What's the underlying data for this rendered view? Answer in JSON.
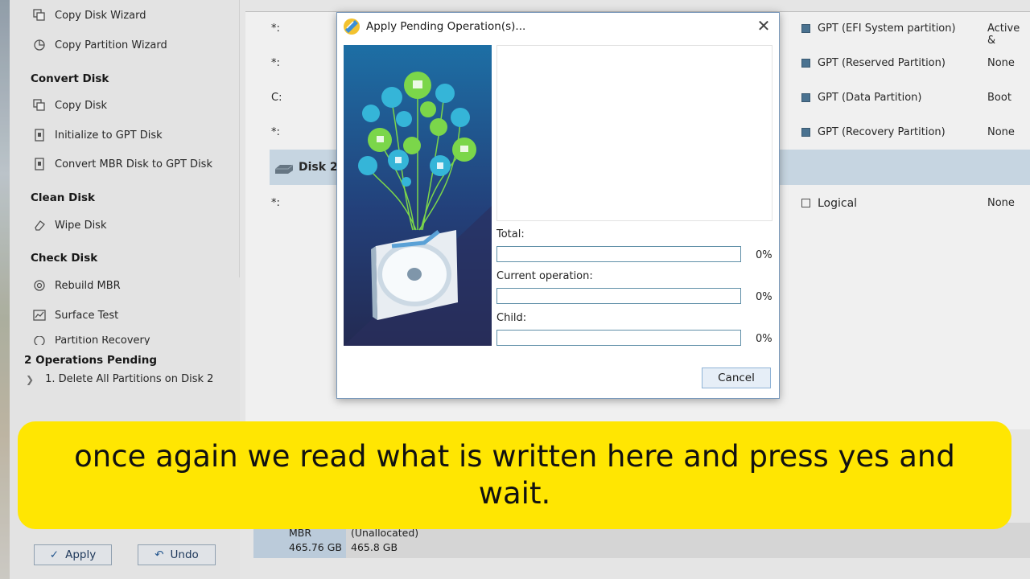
{
  "sidebar": {
    "items_top": [
      {
        "label": "Copy Disk Wizard",
        "icon": "copy-disk-icon"
      },
      {
        "label": "Copy Partition Wizard",
        "icon": "copy-partition-icon"
      }
    ],
    "sections": [
      {
        "title": "Convert Disk",
        "items": [
          {
            "label": "Copy Disk",
            "icon": "copy-icon"
          },
          {
            "label": "Initialize to GPT Disk",
            "icon": "gpt-icon"
          },
          {
            "label": "Convert MBR Disk to GPT Disk",
            "icon": "convert-icon"
          }
        ]
      },
      {
        "title": "Clean Disk",
        "items": [
          {
            "label": "Wipe Disk",
            "icon": "eraser-icon"
          }
        ]
      },
      {
        "title": "Check Disk",
        "items": [
          {
            "label": "Rebuild MBR",
            "icon": "rebuild-icon"
          },
          {
            "label": "Surface Test",
            "icon": "chart-icon"
          },
          {
            "label": "Partition Recovery",
            "icon": "recovery-icon"
          }
        ]
      }
    ],
    "operations": {
      "title": "2 Operations Pending",
      "items": [
        "1. Delete All Partitions on Disk 2"
      ]
    },
    "apply_label": "Apply",
    "undo_label": "Undo"
  },
  "main": {
    "partitions": [
      {
        "name": "*:",
        "type": "GPT (EFI System partition)",
        "status": "Active &"
      },
      {
        "name": "*:",
        "type": "GPT (Reserved Partition)",
        "status": "None"
      },
      {
        "name": "C:",
        "type": "GPT (Data Partition)",
        "status": "Boot"
      },
      {
        "name": "*:",
        "type": "GPT (Recovery Partition)",
        "status": "None"
      }
    ],
    "disk2_label": "Disk 2",
    "disk2_partition": {
      "name": "*:",
      "type": "Logical",
      "status": "None"
    },
    "disk_map": {
      "style": "MBR",
      "capacity": "465.76 GB",
      "part_label": "(Unallocated)",
      "part_size": "465.8 GB"
    }
  },
  "dialog": {
    "title": "Apply Pending Operation(s)...",
    "total_label": "Total:",
    "total_pct": "0%",
    "total_value": 0,
    "current_label": "Current operation:",
    "current_pct": "0%",
    "current_value": 0,
    "child_label": "Child:",
    "child_pct": "0%",
    "child_value": 0,
    "cancel_label": "Cancel"
  },
  "caption": {
    "text": "once again we read what is written here and press yes and wait."
  },
  "colors": {
    "caption_bg": "#ffe602",
    "selected_row": "#d3e3f0",
    "art_top": "#1d6fa5",
    "art_bottom": "#232a52"
  }
}
